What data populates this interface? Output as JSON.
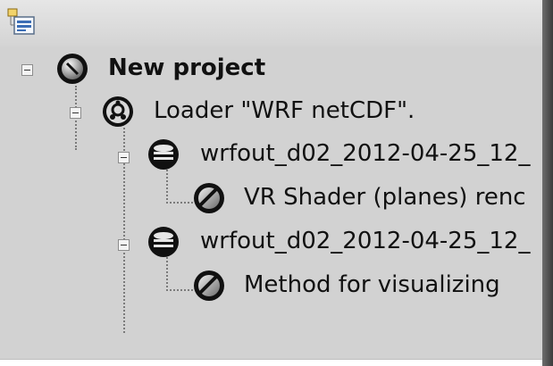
{
  "toolbar": {
    "icon": "project-tree-icon"
  },
  "tree": {
    "root": {
      "label": "New project",
      "icon": "project-node-icon"
    },
    "loader": {
      "label": "Loader \"WRF netCDF\".",
      "icon": "gear-icon"
    },
    "file1": {
      "label": "wrfout_d02_2012-04-25_12_",
      "icon": "database-icon"
    },
    "renderer1": {
      "label": "VR Shader (planes) renc",
      "icon": "renderer-icon"
    },
    "file2": {
      "label": "wrfout_d02_2012-04-25_12_",
      "icon": "database-icon"
    },
    "renderer2": {
      "label": "Method for visualizing",
      "icon": "renderer-icon"
    }
  }
}
